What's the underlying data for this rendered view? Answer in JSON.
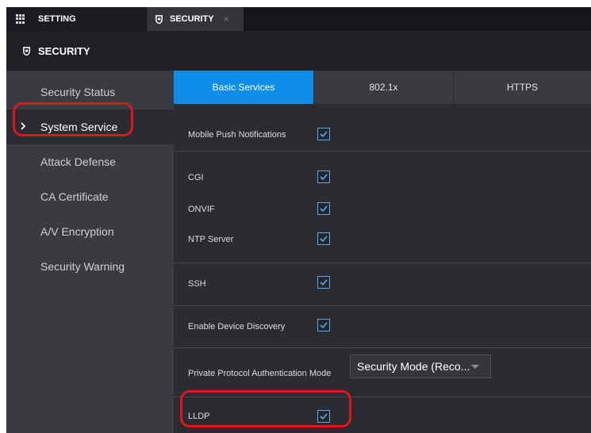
{
  "topbar": {
    "tabs": [
      {
        "label": "SETTING",
        "icon": "grid-icon"
      },
      {
        "label": "SECURITY",
        "icon": "shield-icon",
        "close": "×"
      }
    ]
  },
  "section": {
    "title": "SECURITY",
    "icon": "shield-icon"
  },
  "sidebar": {
    "items": [
      {
        "label": "Security Status"
      },
      {
        "label": "System Service",
        "active": true,
        "marker": "chevron-right-icon"
      },
      {
        "label": "Attack Defense"
      },
      {
        "label": "CA Certificate"
      },
      {
        "label": "A/V Encryption"
      },
      {
        "label": "Security Warning"
      }
    ]
  },
  "subtabs": [
    {
      "label": "Basic Services",
      "active": true
    },
    {
      "label": "802.1x"
    },
    {
      "label": "HTTPS"
    }
  ],
  "settings": {
    "mobile_push": {
      "label": "Mobile Push Notifications",
      "checked": true
    },
    "cgi": {
      "label": "CGI",
      "checked": true
    },
    "onvif": {
      "label": "ONVIF",
      "checked": true
    },
    "ntp": {
      "label": "NTP Server",
      "checked": true
    },
    "ssh": {
      "label": "SSH",
      "checked": true
    },
    "discovery": {
      "label": "Enable Device Discovery",
      "checked": true
    },
    "auth_mode": {
      "label": "Private Protocol Authentication Mode",
      "value": "Security Mode (Reco..."
    },
    "lldp": {
      "label": "LLDP",
      "checked": true
    }
  },
  "colors": {
    "accent": "#0d8ee8",
    "highlight": "#e0161c",
    "checkbox_border": "#5aa9ea"
  }
}
